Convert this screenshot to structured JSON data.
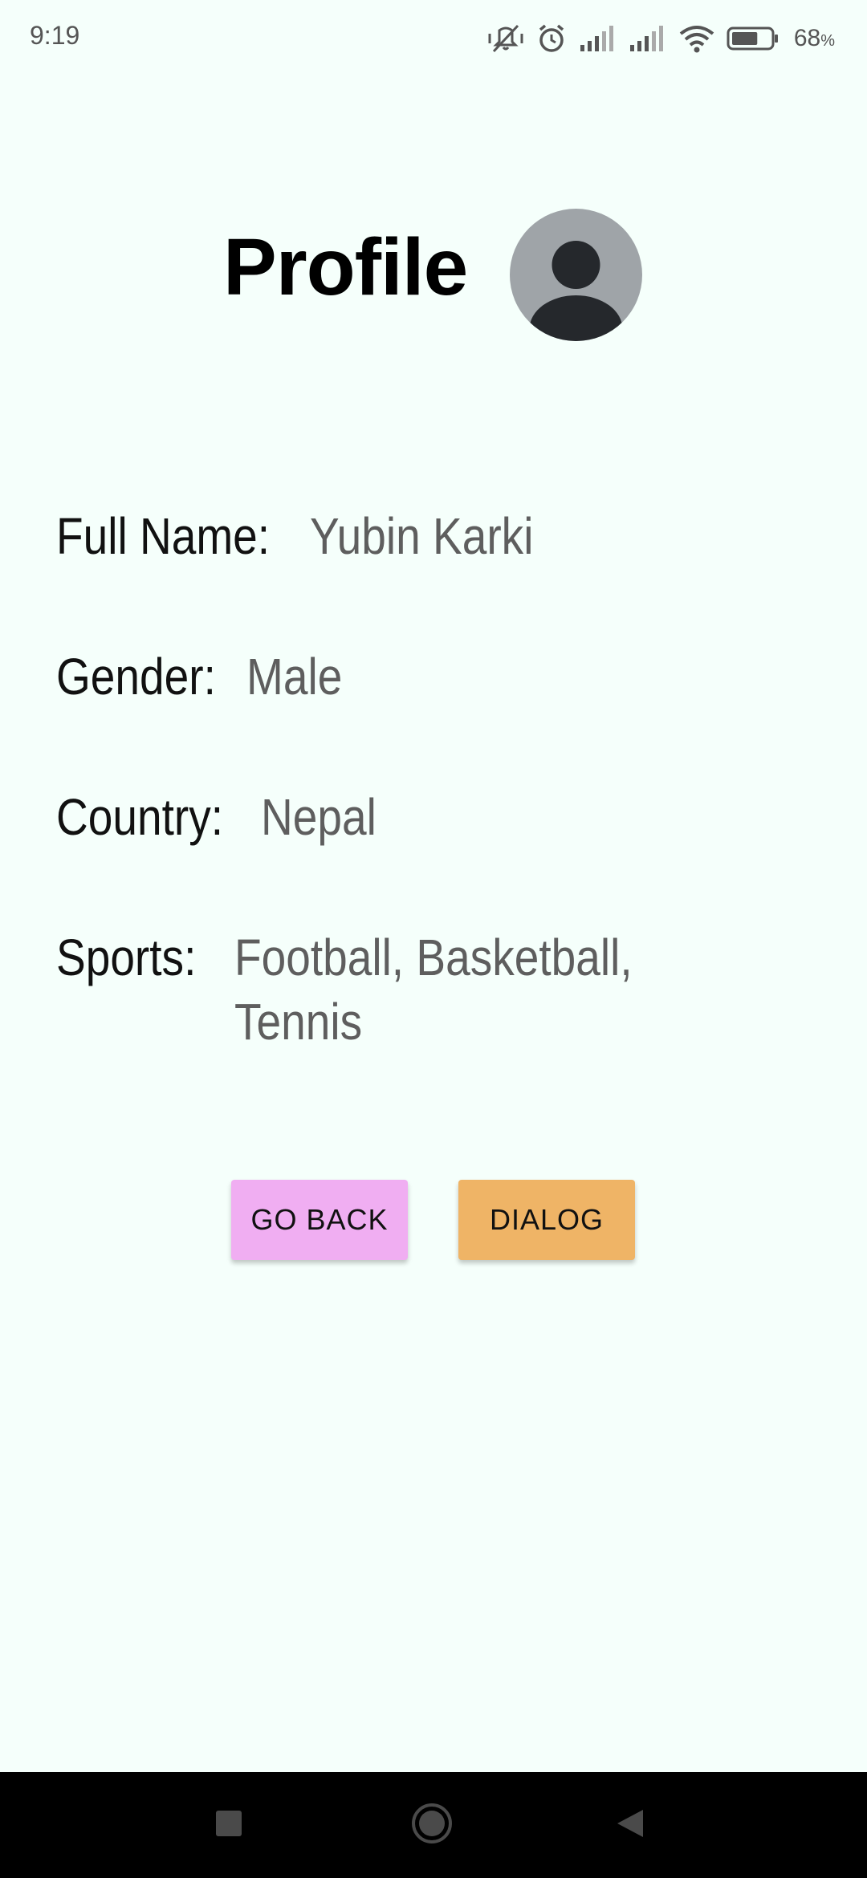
{
  "status_bar": {
    "time": "9:19",
    "battery_percent": "68",
    "battery_unit": "%",
    "battery_level": 0.68,
    "icons": [
      "mute-vibrate-icon",
      "alarm-icon",
      "signal-icon",
      "signal-icon",
      "wifi-icon",
      "battery-icon"
    ]
  },
  "header": {
    "title": "Profile",
    "avatar_icon": "person-avatar-icon",
    "avatar_bg": "#9fa4a8"
  },
  "profile": {
    "fields": [
      {
        "label": "Full Name:",
        "value": "Yubin Karki"
      },
      {
        "label": "Gender:",
        "value": "Male"
      },
      {
        "label": "Country:",
        "value": "Nepal"
      },
      {
        "label": "Sports:",
        "value": "Football, Basketball, Tennis"
      }
    ]
  },
  "buttons": {
    "go_back": "GO BACK",
    "dialog": "DIALOG",
    "go_back_color": "#f0aef2",
    "dialog_color": "#efb466"
  },
  "nav": {
    "icons": [
      "recent-apps-icon",
      "home-icon",
      "back-icon"
    ]
  }
}
